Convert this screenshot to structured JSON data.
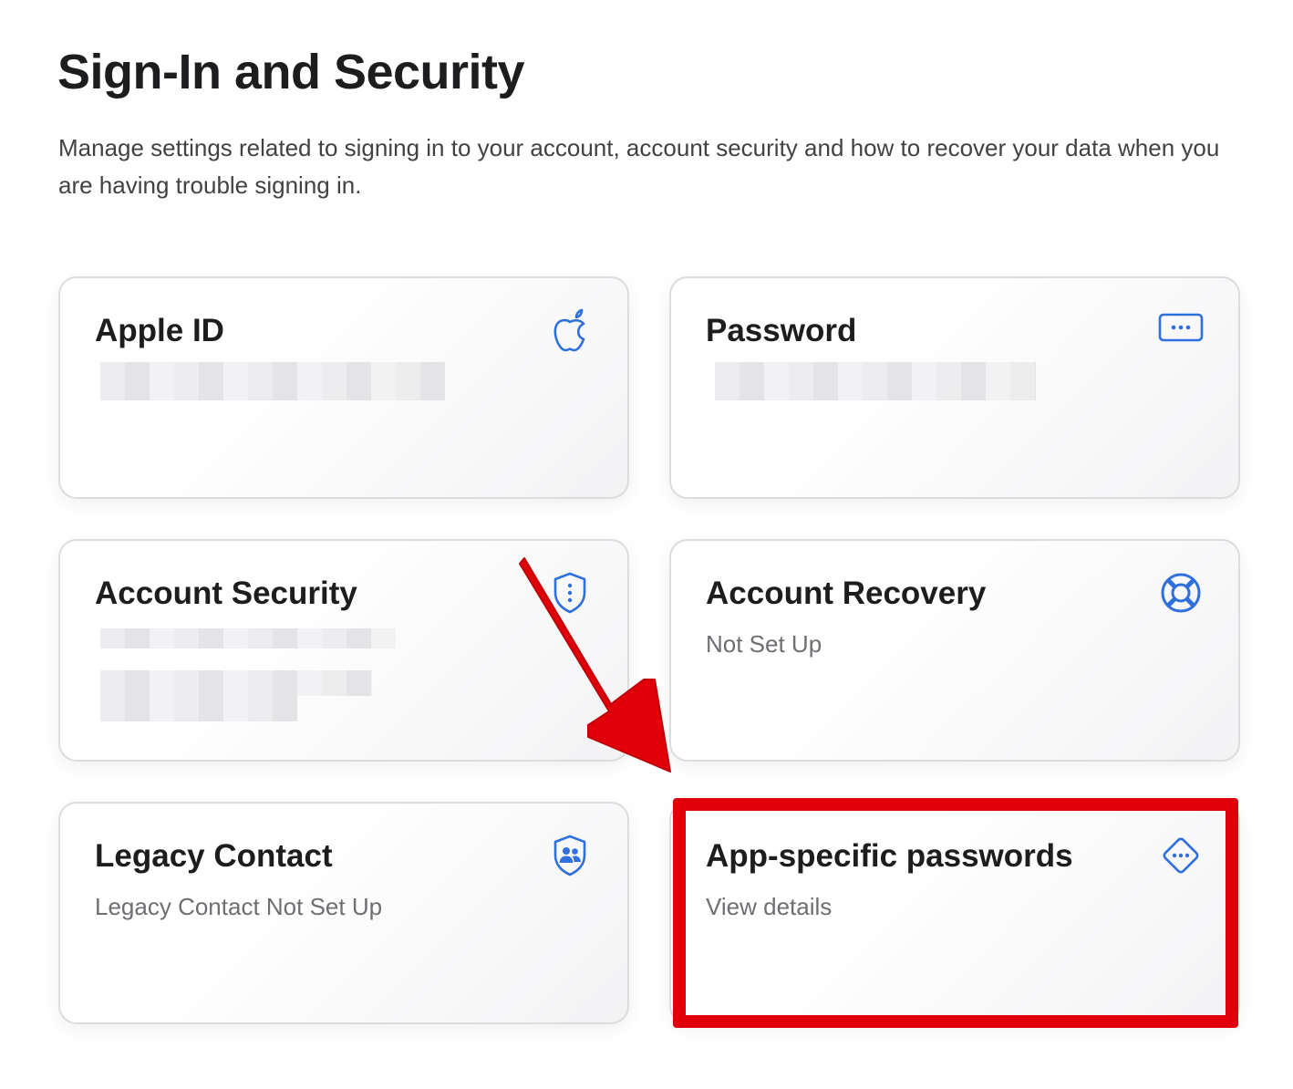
{
  "header": {
    "title": "Sign-In and Security",
    "description": "Manage settings related to signing in to your account, account security and how to recover your data when you are having trouble signing in."
  },
  "cards": {
    "apple_id": {
      "title": "Apple ID",
      "icon": "apple-logo-icon"
    },
    "password": {
      "title": "Password",
      "icon": "password-dots-icon"
    },
    "account_security": {
      "title": "Account Security",
      "icon": "shield-icon"
    },
    "account_recovery": {
      "title": "Account Recovery",
      "subtitle": "Not Set Up",
      "icon": "lifebuoy-icon"
    },
    "legacy_contact": {
      "title": "Legacy Contact",
      "subtitle": "Legacy Contact Not Set Up",
      "icon": "shield-people-icon"
    },
    "app_specific_passwords": {
      "title": "App-specific passwords",
      "subtitle": "View details",
      "icon": "diamond-dots-icon"
    }
  },
  "colors": {
    "accent": "#2f6fde",
    "annotation_red": "#e0000a"
  }
}
